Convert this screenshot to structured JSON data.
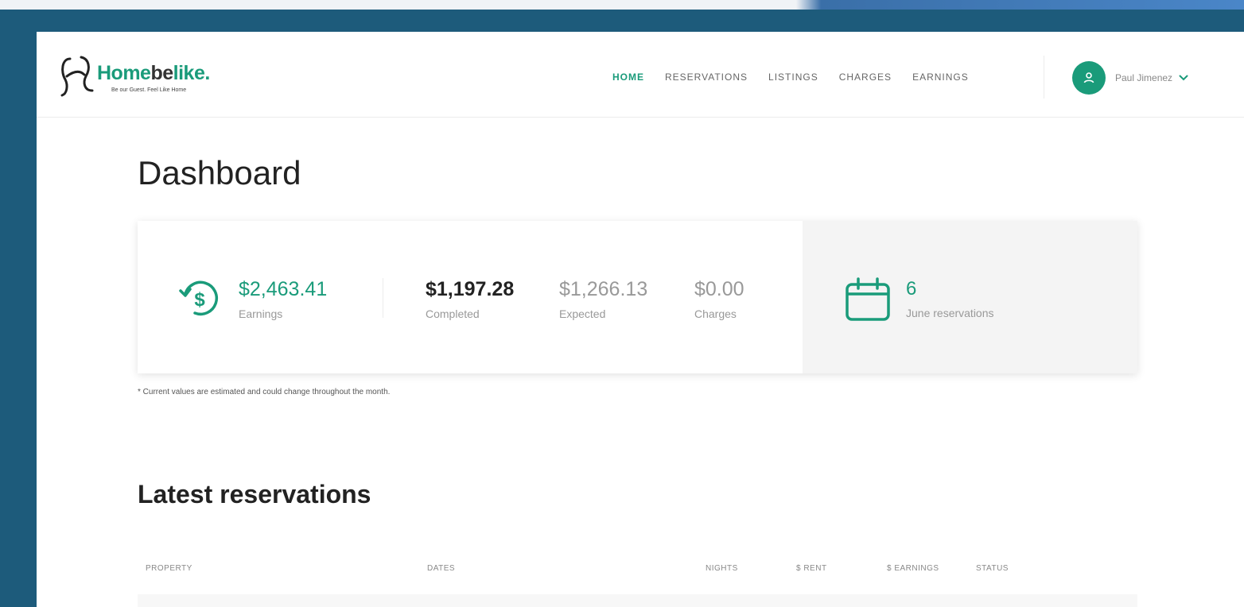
{
  "brand": {
    "name_part_a": "Home",
    "name_part_b": "be",
    "name_part_c": "like",
    "tagline": "Be our Guest. Feel Like Home",
    "color": "#1a9b7a"
  },
  "nav": {
    "items": [
      {
        "label": "HOME",
        "active": true
      },
      {
        "label": "RESERVATIONS",
        "active": false
      },
      {
        "label": "LISTINGS",
        "active": false
      },
      {
        "label": "CHARGES",
        "active": false
      },
      {
        "label": "EARNINGS",
        "active": false
      }
    ]
  },
  "user": {
    "name": "Paul Jimenez",
    "avatar_icon": "user-icon",
    "menu_icon": "chevron-down-icon"
  },
  "dashboard": {
    "title": "Dashboard",
    "earnings": {
      "value": "$2,463.41",
      "label": "Earnings",
      "icon": "dollar-cycle-icon"
    },
    "completed": {
      "value": "$1,197.28",
      "label": "Completed"
    },
    "expected": {
      "value": "$1,266.13",
      "label": "Expected"
    },
    "charges": {
      "value": "$0.00",
      "label": "Charges"
    },
    "reservations": {
      "value": "6",
      "label": "June reservations",
      "icon": "calendar-icon"
    },
    "note": "* Current values are estimated and could change throughout the month."
  },
  "latest": {
    "title": "Latest reservations",
    "columns": [
      "PROPERTY",
      "DATES",
      "NIGHTS",
      "$ RENT",
      "$ EARNINGS",
      "STATUS"
    ]
  }
}
